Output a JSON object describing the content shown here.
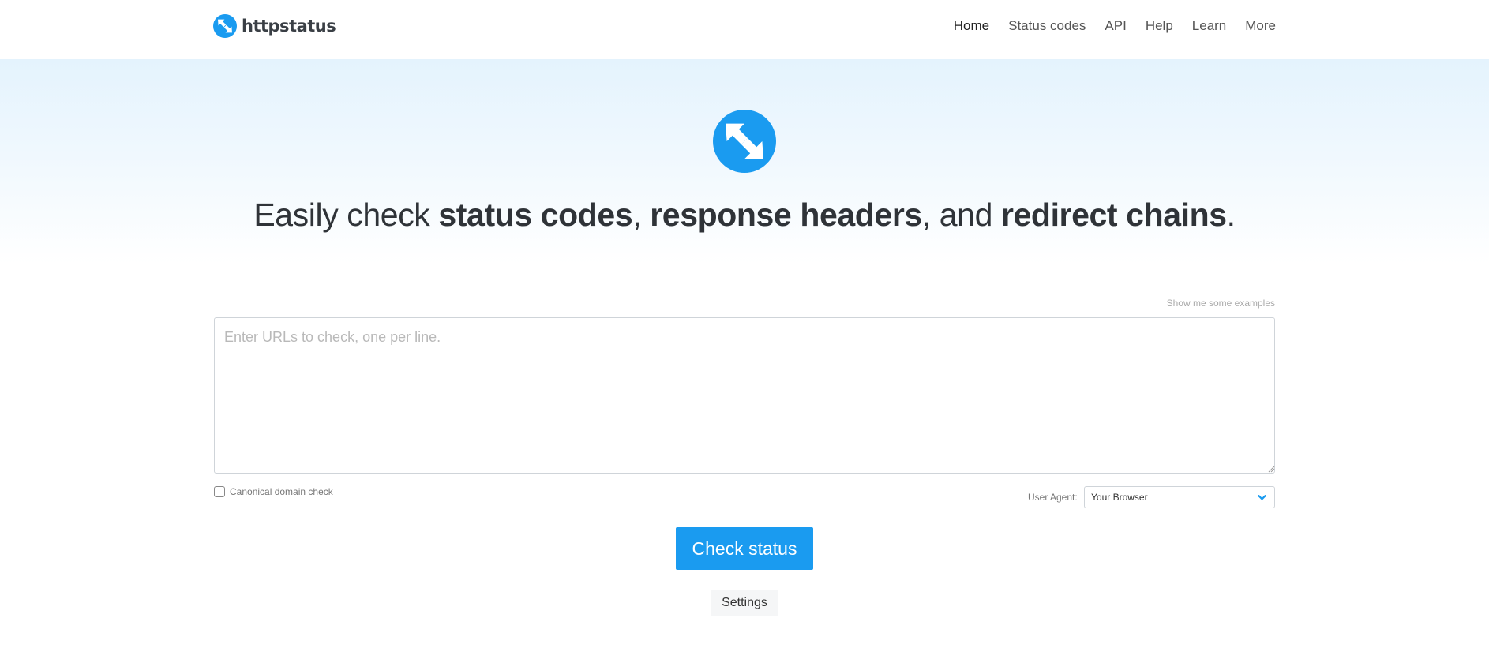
{
  "brand": {
    "name": "httpstatus",
    "icon": "arrows-exchange-icon",
    "color": "#1a9bf0"
  },
  "nav": {
    "items": [
      {
        "label": "Home",
        "active": true
      },
      {
        "label": "Status codes"
      },
      {
        "label": "API"
      },
      {
        "label": "Help"
      },
      {
        "label": "Learn"
      },
      {
        "label": "More"
      }
    ]
  },
  "hero": {
    "icon": "arrows-exchange-icon",
    "headline": {
      "part1": "Easily check ",
      "bold1": "status codes",
      "part2": ", ",
      "bold2": "response headers",
      "part3": ", and ",
      "bold3": "redirect chains",
      "part4": "."
    }
  },
  "form": {
    "examples_link": "Show me some examples",
    "urls": {
      "value": "",
      "placeholder": "Enter URLs to check, one per line."
    },
    "canonical_label": "Canonical domain check",
    "canonical_checked": false,
    "user_agent_label": "User Agent:",
    "user_agent_value": "Your Browser",
    "submit_label": "Check status",
    "settings_label": "Settings"
  },
  "colors": {
    "accent": "#1a9bf0",
    "hero_gradient_top": "#e4f3fd"
  }
}
